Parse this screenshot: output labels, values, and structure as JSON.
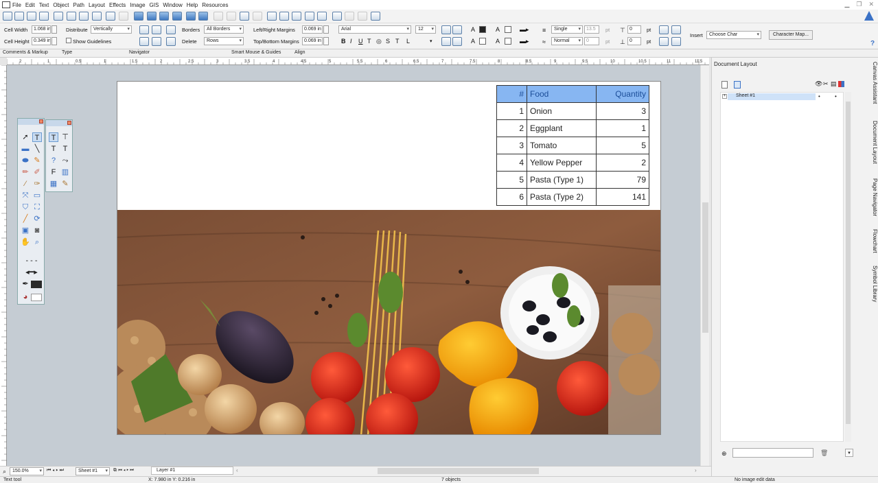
{
  "menu": [
    "File",
    "Edit",
    "Text",
    "Object",
    "Path",
    "Layout",
    "Effects",
    "Image",
    "GIS",
    "Window",
    "Help",
    "Resources"
  ],
  "toolbar2": {
    "cell_width_label": "Cell Width",
    "cell_width_value": "1.068 in",
    "cell_height_label": "Cell Height",
    "cell_height_value": "0.349 in",
    "distribute_label": "Distribute",
    "distribute_value": "Vertically",
    "show_guidelines_label": "Show Guidelines",
    "borders_label": "Borders",
    "borders_value": "All Borders",
    "delete_label": "Delete",
    "delete_value": "Rows",
    "lr_margins_label": "Left/Right Margins",
    "lr_margins_value": "0.069 in",
    "tb_margins_label": "Top/Bottom Margins",
    "tb_margins_value": "0.069 in",
    "font_value": "Arial",
    "font_size_value": "12",
    "bold": "B",
    "italic": "I",
    "underline": "U",
    "line_style_value": "Single",
    "line_width_value": "13.5",
    "line_width_unit": "pt",
    "blend_value": "Normal",
    "offset_value": "0",
    "offset_unit": "pt",
    "spacing_top_value": "0",
    "spacing_bottom_value": "0",
    "spacing_unit": "pt",
    "insert_label": "Insert",
    "insert_value": "Choose Char",
    "char_map_button": "Character Map..."
  },
  "toolbar3": [
    "Comments & Markup",
    "Type",
    "Navigator",
    "Smart Mouse & Guides",
    "Align"
  ],
  "ruler_labels": [
    "2",
    "1",
    "0.5",
    "1",
    "1.5",
    "2",
    "2.5",
    "3",
    "3.5",
    "4",
    "4.5",
    "5",
    "5.5",
    "6",
    "6.5",
    "7",
    "7.5",
    "8",
    "8.5",
    "9",
    "9.5",
    "10",
    "10.5",
    "11",
    "11.5"
  ],
  "table": {
    "headers": [
      "#",
      "Food",
      "Quantity"
    ],
    "rows": [
      [
        "1",
        "Onion",
        "3"
      ],
      [
        "2",
        "Eggplant",
        "1"
      ],
      [
        "3",
        "Tomato",
        "5"
      ],
      [
        "4",
        "Yellow Pepper",
        "2"
      ],
      [
        "5",
        "Pasta (Type 1)",
        "79"
      ],
      [
        "6",
        "Pasta (Type 2)",
        "141"
      ]
    ]
  },
  "right_panel": {
    "title": "Document Layout",
    "sheet_name": "Sheet #1"
  },
  "vertical_tabs": [
    "Canvas Assistant",
    "Document Layout",
    "Page Navigator",
    "Flowchart",
    "Symbol Library"
  ],
  "bottom": {
    "zoom": "150.0%",
    "sheet": "Sheet #1",
    "layer": "Layer #1"
  },
  "status": {
    "tool": "Text tool",
    "coords": "X: 7.980 in Y: 0.216 in",
    "objects": "7 objects",
    "image_edit": "No image edit data"
  },
  "colors": {
    "table_header_bg": "#87b6f2",
    "table_header_text": "#1c4e99",
    "selection": "#cfe2f8"
  }
}
